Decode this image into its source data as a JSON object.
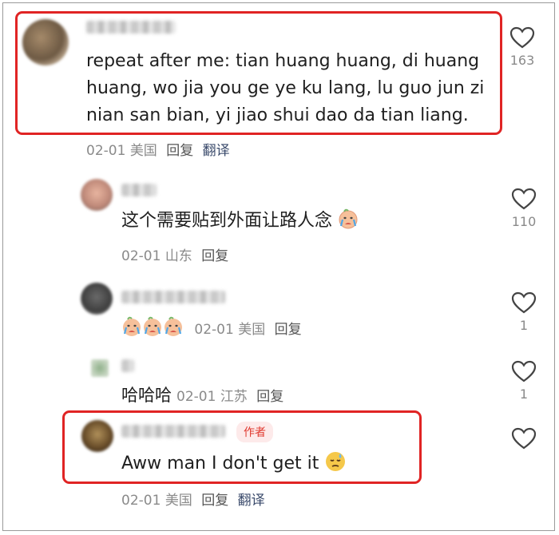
{
  "comments": [
    {
      "username": "•••••• ••• •••",
      "text": "repeat after me: tian huang huang, di huang huang, wo jia you ge ye ku lang, lu guo jun zi nian san bian, yi jiao shui dao da tian liang.",
      "date": "02-01",
      "location": "美国",
      "reply": "回复",
      "translate": "翻译",
      "likes": "163"
    },
    {
      "username": "•• •",
      "text": "这个需要贴到外面让路人念",
      "date": "02-01",
      "location": "山东",
      "reply": "回复",
      "likes": "110"
    },
    {
      "username": "•••••••••••••",
      "date": "02-01",
      "location": "美国",
      "reply": "回复",
      "likes": "1"
    },
    {
      "username": "•",
      "text": "哈哈哈",
      "date": "02-01",
      "location": "江苏",
      "reply": "回复",
      "likes": "1"
    },
    {
      "username": "••••••• •• ••",
      "author_badge": "作者",
      "text": "Aww man I don't get it",
      "date": "02-01",
      "location": "美国",
      "reply": "回复",
      "translate": "翻译",
      "likes": ""
    }
  ],
  "colors": {
    "highlight": "#e02424",
    "author_badge_bg": "#fdeaea",
    "author_badge_text": "#e0392f",
    "meta": "#8a8a8a"
  },
  "icons": {
    "like": "heart-outline-icon",
    "cry_emoji": "crying-face-emoji",
    "sweat_emoji": "downcast-sweat-face-emoji"
  }
}
